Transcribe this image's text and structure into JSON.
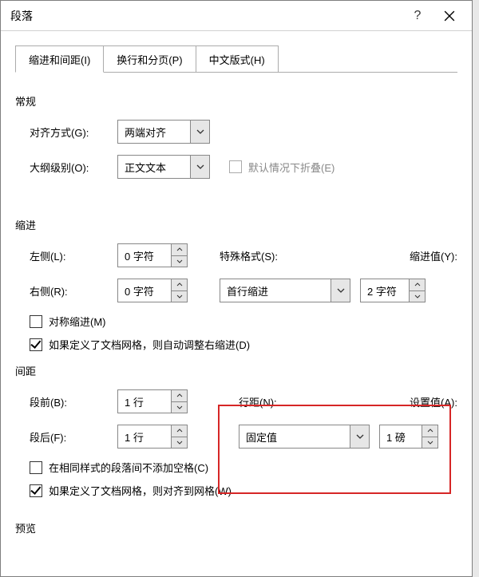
{
  "window": {
    "title": "段落"
  },
  "tabs": {
    "t1": "缩进和间距(I)",
    "t2": "换行和分页(P)",
    "t3": "中文版式(H)"
  },
  "sections": {
    "general": "常规",
    "indent": "缩进",
    "spacing": "间距",
    "preview": "预览"
  },
  "general": {
    "align_label": "对齐方式(G):",
    "align_value": "两端对齐",
    "outline_label": "大纲级别(O):",
    "outline_value": "正文文本",
    "collapsed_label": "默认情况下折叠(E)"
  },
  "indent": {
    "left_label": "左侧(L):",
    "left_value": "0 字符",
    "right_label": "右侧(R):",
    "right_value": "0 字符",
    "special_label": "特殊格式(S):",
    "special_value": "首行缩进",
    "by_label": "缩进值(Y):",
    "by_value": "2 字符",
    "mirror_label": "对称缩进(M)",
    "grid_label": "如果定义了文档网格，则自动调整右缩进(D)"
  },
  "spacing": {
    "before_label": "段前(B):",
    "before_value": "1 行",
    "after_label": "段后(F):",
    "after_value": "1 行",
    "linespacing_label": "行距(N):",
    "linespacing_value": "固定值",
    "at_label": "设置值(A):",
    "at_value": "1 磅",
    "noadd_label": "在相同样式的段落间不添加空格(C)",
    "snap_label": "如果定义了文档网格，则对齐到网格(W)"
  }
}
